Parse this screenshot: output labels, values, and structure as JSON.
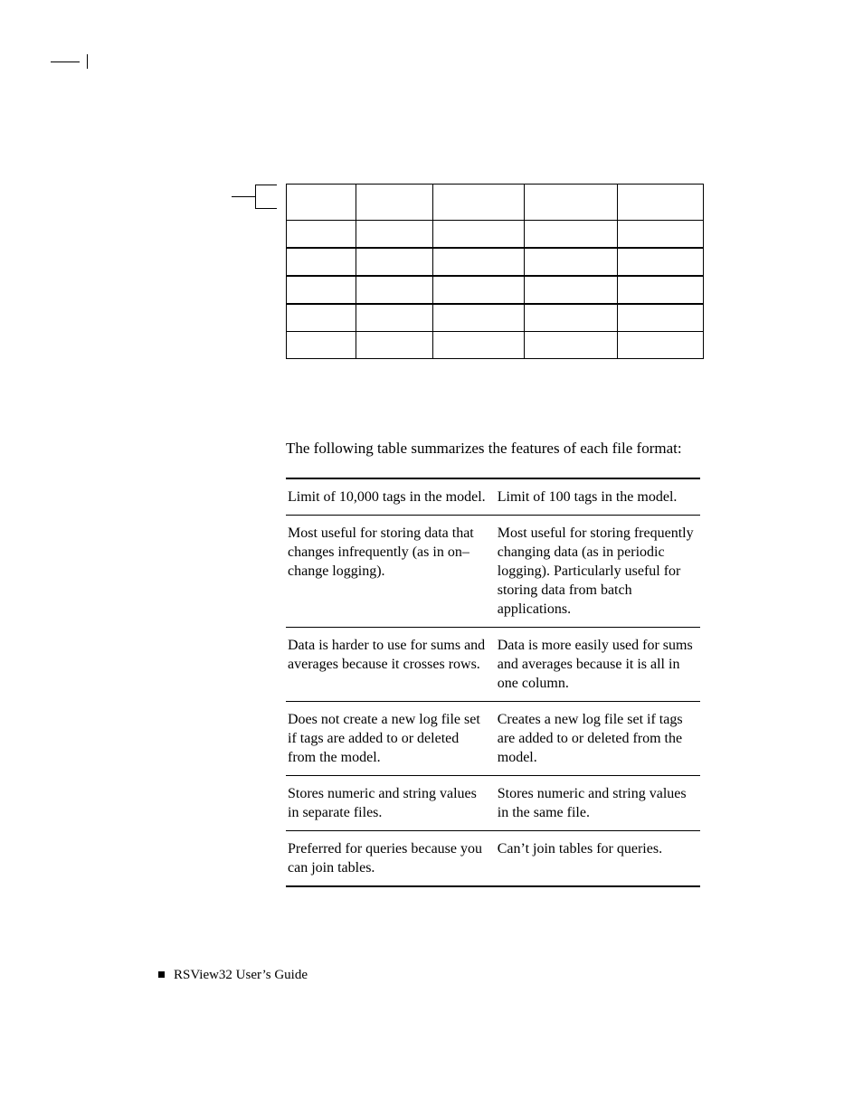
{
  "para": "The following table summarizes the features of each file format:",
  "rows": [
    {
      "a": "Limit of 10,000 tags in the model.",
      "b": "Limit of 100 tags in the model."
    },
    {
      "a": "Most useful for storing data that changes infrequently (as in on–change logging).",
      "b": "Most useful for storing frequently changing data (as in periodic logging). Particularly useful for storing data from batch applications."
    },
    {
      "a": "Data is harder to use for sums and averages because it crosses rows.",
      "b": "Data is more easily used for sums and averages because it is all in one column."
    },
    {
      "a": "Does not create a new log file set if tags are added to or deleted from the model.",
      "b": "Creates a new log file set if tags are added to or deleted from the model."
    },
    {
      "a": "Stores numeric and string values in separate files.",
      "b": "Stores numeric and string values in the same file."
    },
    {
      "a": "Preferred for queries because you can join tables.",
      "b": "Can’t join tables for queries."
    }
  ],
  "footer": "RSView32  User’s Guide"
}
